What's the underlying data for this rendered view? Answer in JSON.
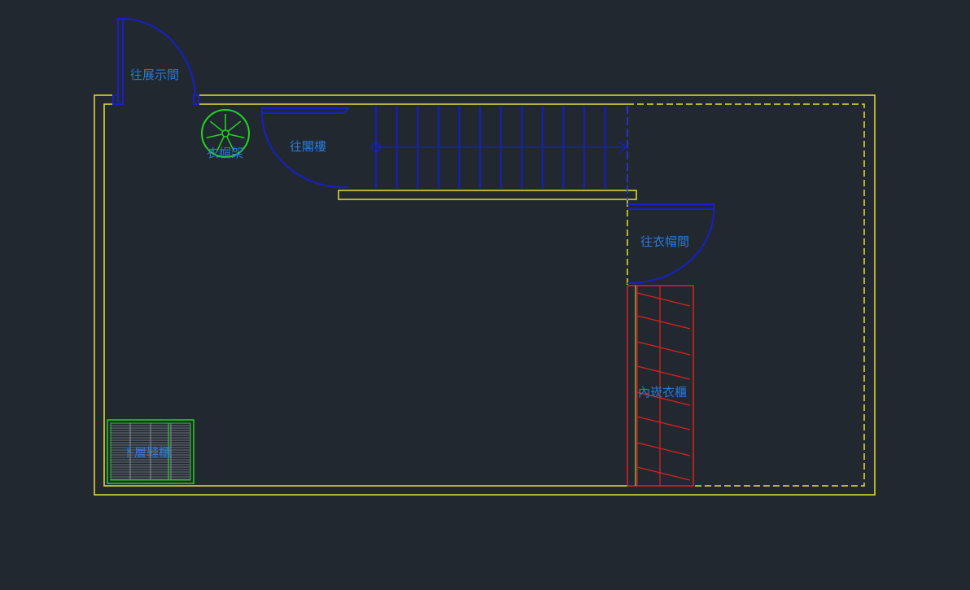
{
  "labels": {
    "to_showroom": "往展示間",
    "to_loft": "往閣樓",
    "hat_rack": "衣帽架",
    "to_cloakroom": "往衣帽間",
    "inner_wardrobe": "內崁衣櫃",
    "shoe_cabinet": "下層鞋櫃"
  },
  "colors": {
    "background": "#212830",
    "wall": "#e8e032",
    "door": "#1820c8",
    "label": "#2a7ad8",
    "furniture_green": "#22d422",
    "wardrobe": "#e02020",
    "stair": "#1420c0",
    "stair_dash": "#3434e8"
  }
}
